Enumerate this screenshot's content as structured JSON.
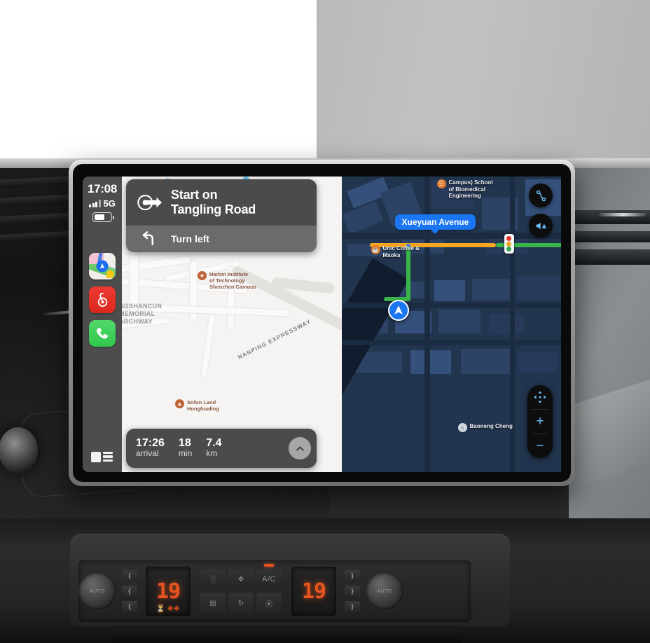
{
  "device": {
    "name": "car-head-unit-display"
  },
  "carplay": {
    "status": {
      "time": "17:08",
      "network": "5G",
      "signal_icon": "cellular-bars-icon",
      "battery_icon": "battery-icon",
      "battery_level_pct": 62
    },
    "dock": {
      "apps": [
        {
          "name": "Maps",
          "icon": "apple-maps-icon"
        },
        {
          "name": "NetEase Cloud Music",
          "icon": "netease-music-icon"
        },
        {
          "name": "Phone",
          "icon": "phone-icon"
        }
      ],
      "dashboard_button_icon": "dashboard-split-view-icon"
    },
    "navigation": {
      "banner": {
        "primary_instruction_line1": "Start on",
        "primary_instruction_line2": "Tangling Road",
        "primary_icon": "start-route-arrow-icon",
        "next_instruction": "Turn left",
        "next_icon": "turn-left-arrow-icon"
      },
      "eta": {
        "arrival_time": "17:26",
        "arrival_label": "arrival",
        "duration_value": "18",
        "duration_label": "min",
        "distance_value": "7.4",
        "distance_label": "km",
        "expand_icon": "chevron-up-icon"
      },
      "controls": {
        "route_overview_icon": "route-overview-icon",
        "audio_alerts_icon": "speaker-alerts-icon",
        "pan_icon": "pan-arrows-icon",
        "zoom_in_label": "+",
        "zoom_out_label": "−"
      }
    },
    "map_light": {
      "pois": [
        {
          "icon": "university-icon",
          "label": "Harbin Institute\nof Technology\nShenzhen Camous"
        },
        {
          "icon": "park-icon",
          "label": "Sofun Land\nHonghualing"
        }
      ],
      "place_labels": [
        "NGSHANCUN\nMEMORIAL\nARCHWAY"
      ],
      "road_labels": [
        "NANPING EXPRESSWAY"
      ]
    },
    "map_dark": {
      "street_label": "Xueyuan Avenue",
      "pois": [
        {
          "icon": "university-icon",
          "label": "Campus) School\nof Biomedical\nEngineering"
        },
        {
          "icon": "cafe-icon",
          "label": "Unic Coffee &\nMaoka"
        },
        {
          "icon": "building-icon",
          "label": "Baoneng Cheng"
        }
      ],
      "traffic_light_icon": "traffic-light-icon",
      "user_location_icon": "navigation-puck-icon"
    }
  },
  "climate": {
    "left_temp": "19",
    "right_temp": "19",
    "left_knob_label": "AUTO",
    "right_knob_label": "AUTO",
    "buttons": [
      {
        "name": "front-defrost",
        "glyph": "▢"
      },
      {
        "name": "air-distribution",
        "glyph": "✦"
      },
      {
        "name": "ac-toggle",
        "glyph": "A/C"
      },
      {
        "name": "rear-defrost",
        "glyph": "☰"
      },
      {
        "name": "recirculate",
        "glyph": "↻"
      },
      {
        "name": "fan-off",
        "glyph": "◁"
      }
    ]
  },
  "colors": {
    "accent_blue": "#1b76f2",
    "route_green": "#39b54a",
    "route_orange": "#f5a623",
    "banner_grey": "#4b4b4b",
    "sidebar_grey": "#4d4d4d",
    "hvac_orange": "#e8541f"
  }
}
